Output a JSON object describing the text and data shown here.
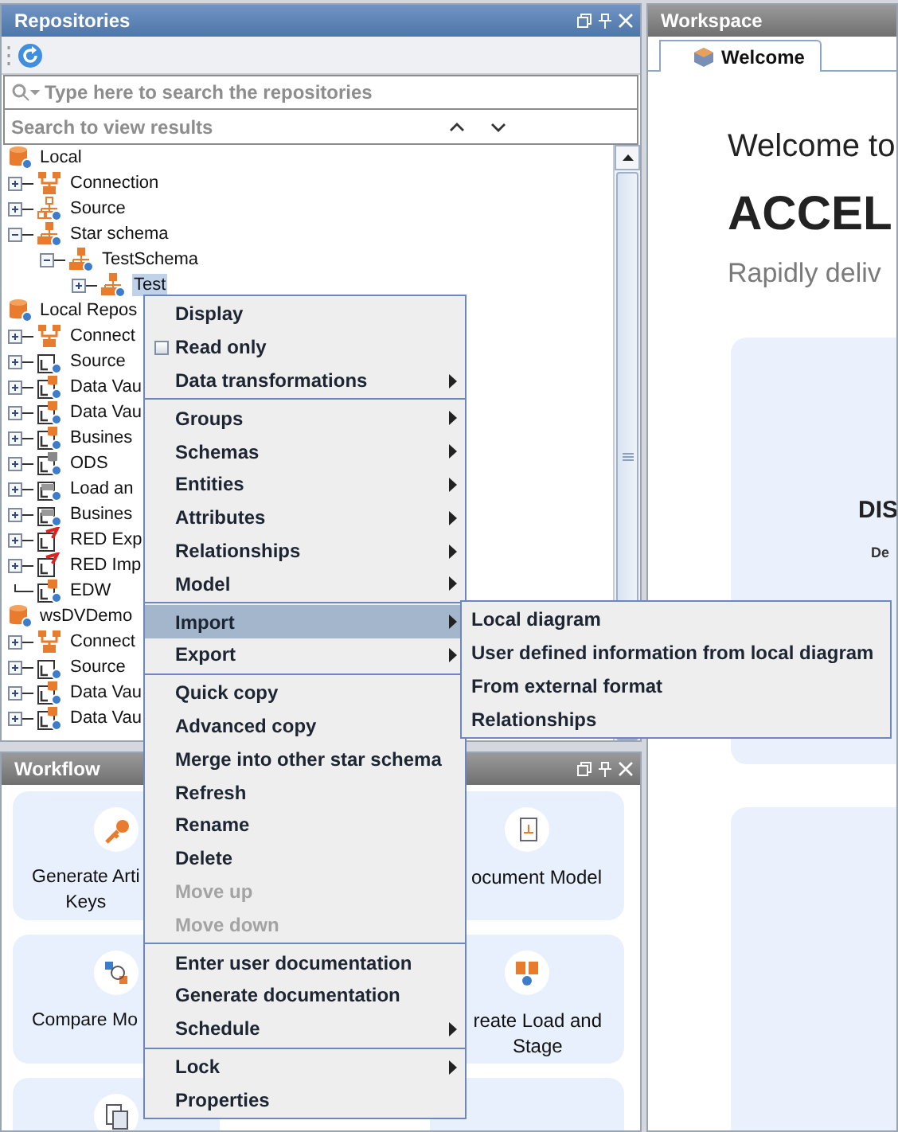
{
  "repositories": {
    "title": "Repositories",
    "search": {
      "placeholder": "Type here to search the repositories"
    },
    "results": "Search to view results",
    "tree": [
      {
        "label": "Local",
        "kind": "repository",
        "selected": false,
        "children": [
          {
            "label": "Connection",
            "kind": "connection",
            "expanded": false,
            "selected": false
          },
          {
            "label": "Source",
            "kind": "source",
            "expanded": false,
            "selected": false
          },
          {
            "label": "Star schema",
            "kind": "star",
            "expanded": true,
            "selected": false,
            "children": [
              {
                "label": "TestSchema",
                "kind": "star",
                "expanded": true,
                "selected": false,
                "children": [
                  {
                    "label": "Test",
                    "kind": "star",
                    "expanded": false,
                    "selected": true
                  }
                ]
              }
            ]
          }
        ]
      },
      {
        "label": "Local Repos",
        "kind": "repository",
        "selected": false,
        "children": [
          {
            "label": "Connect",
            "kind": "connection",
            "expanded": false,
            "selected": false
          },
          {
            "label": "Source",
            "kind": "layer",
            "expanded": false,
            "selected": false
          },
          {
            "label": "Data Vau",
            "kind": "layer-db",
            "expanded": false,
            "selected": false
          },
          {
            "label": "Data Vau",
            "kind": "layer-db",
            "expanded": false,
            "selected": false
          },
          {
            "label": "Busines",
            "kind": "layer-db",
            "expanded": false,
            "selected": false
          },
          {
            "label": "ODS",
            "kind": "ods",
            "expanded": false,
            "selected": false
          },
          {
            "label": "Load an",
            "kind": "layer-grey",
            "expanded": false,
            "selected": false
          },
          {
            "label": "Busines",
            "kind": "layer-grey",
            "expanded": false,
            "selected": false
          },
          {
            "label": "RED Exp",
            "kind": "red",
            "expanded": false,
            "selected": false
          },
          {
            "label": "RED Imp",
            "kind": "red",
            "expanded": false,
            "selected": false
          },
          {
            "label": "EDW",
            "kind": "layer-db",
            "selected": false
          }
        ]
      },
      {
        "label": "wsDVDemo",
        "kind": "repository",
        "selected": false,
        "children": [
          {
            "label": "Connect",
            "kind": "connection",
            "expanded": false,
            "selected": false
          },
          {
            "label": "Source",
            "kind": "layer",
            "expanded": false,
            "selected": false
          },
          {
            "label": "Data Vau",
            "kind": "layer-db",
            "expanded": false,
            "selected": false
          },
          {
            "label": "Data Vau",
            "kind": "layer-db",
            "expanded": false,
            "selected": false
          }
        ]
      }
    ]
  },
  "context_menu": {
    "sections": [
      [
        {
          "label": "Display",
          "kind": "command",
          "disabled": false,
          "selected": false
        },
        {
          "label": "Read only",
          "kind": "checkbox",
          "checked": false,
          "disabled": false,
          "selected": false
        },
        {
          "label": "Data transformations",
          "kind": "submenu",
          "disabled": false,
          "selected": false
        }
      ],
      [
        {
          "label": "Groups",
          "kind": "submenu",
          "disabled": false,
          "selected": false
        },
        {
          "label": "Schemas",
          "kind": "submenu",
          "disabled": false,
          "selected": false
        },
        {
          "label": "Entities",
          "kind": "submenu",
          "disabled": false,
          "selected": false
        },
        {
          "label": "Attributes",
          "kind": "submenu",
          "disabled": false,
          "selected": false
        },
        {
          "label": "Relationships",
          "kind": "submenu",
          "disabled": false,
          "selected": false
        },
        {
          "label": "Model",
          "kind": "submenu",
          "disabled": false,
          "selected": false
        }
      ],
      [
        {
          "label": "Import",
          "kind": "submenu",
          "disabled": false,
          "selected": true
        },
        {
          "label": "Export",
          "kind": "submenu",
          "disabled": false,
          "selected": false
        }
      ],
      [
        {
          "label": "Quick copy",
          "kind": "command",
          "disabled": false,
          "selected": false
        },
        {
          "label": "Advanced copy",
          "kind": "command",
          "disabled": false,
          "selected": false
        },
        {
          "label": "Merge into other star schema",
          "kind": "command",
          "disabled": false,
          "selected": false
        },
        {
          "label": "Refresh",
          "kind": "command",
          "disabled": false,
          "selected": false
        },
        {
          "label": "Rename",
          "kind": "command",
          "disabled": false,
          "selected": false
        },
        {
          "label": "Delete",
          "kind": "command",
          "disabled": false,
          "selected": false
        },
        {
          "label": "Move up",
          "kind": "command",
          "disabled": true,
          "selected": false
        },
        {
          "label": "Move down",
          "kind": "command",
          "disabled": true,
          "selected": false
        }
      ],
      [
        {
          "label": "Enter user documentation",
          "kind": "command",
          "disabled": false,
          "selected": false
        },
        {
          "label": "Generate documentation",
          "kind": "command",
          "disabled": false,
          "selected": false
        },
        {
          "label": "Schedule",
          "kind": "submenu",
          "disabled": false,
          "selected": false
        }
      ],
      [
        {
          "label": "Lock",
          "kind": "submenu",
          "disabled": false,
          "selected": false
        },
        {
          "label": "Properties",
          "kind": "command",
          "disabled": false,
          "selected": false
        }
      ]
    ]
  },
  "submenu": {
    "items": [
      {
        "label": "Local diagram",
        "selected": false
      },
      {
        "label": "User defined information from local diagram",
        "selected": false
      },
      {
        "label": "From external format",
        "selected": false
      },
      {
        "label": "Relationships",
        "selected": false
      }
    ]
  },
  "workflow": {
    "title": "Workflow",
    "rows": [
      [
        {
          "kind": "card",
          "label": "Generate Arti\nKeys"
        },
        {
          "kind": "card",
          "label": "ocument Model"
        }
      ],
      [
        {
          "kind": "card",
          "label": "Compare Mo"
        },
        {
          "kind": "card",
          "label": "reate Load and\nStage"
        }
      ],
      [
        {
          "kind": "card"
        },
        {
          "kind": "card"
        }
      ]
    ]
  },
  "workspace": {
    "title": "Workspace",
    "tabs": [
      {
        "label": "Welcome",
        "selected": true
      }
    ],
    "heading": "Welcome to",
    "product": "ACCEL",
    "tagline": "Rapidly deliv",
    "cards": [
      {
        "kind": "card",
        "title": "DIS",
        "text": "De"
      },
      {
        "kind": "card"
      }
    ]
  }
}
